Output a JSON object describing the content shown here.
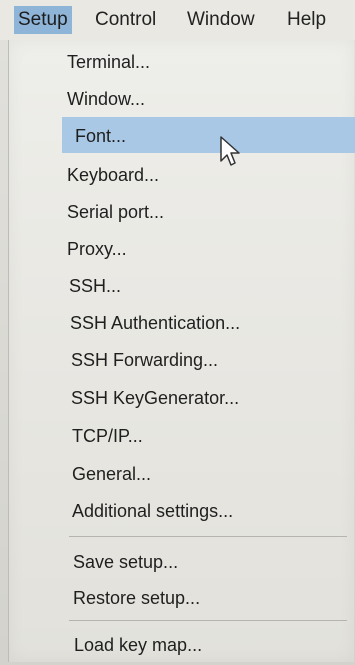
{
  "menubar": {
    "items": [
      {
        "label": "Setup",
        "active": true
      },
      {
        "label": "Control",
        "active": false
      },
      {
        "label": "Window",
        "active": false
      },
      {
        "label": "Help",
        "active": false
      }
    ]
  },
  "setup_menu": {
    "items": [
      {
        "label": "Terminal..."
      },
      {
        "label": "Window..."
      },
      {
        "label": "Font...",
        "highlighted": true
      },
      {
        "label": "Keyboard..."
      },
      {
        "label": "Serial port..."
      },
      {
        "label": "Proxy..."
      },
      {
        "label": "SSH..."
      },
      {
        "label": "SSH Authentication..."
      },
      {
        "label": "SSH Forwarding..."
      },
      {
        "label": "SSH KeyGenerator..."
      },
      {
        "label": "TCP/IP..."
      },
      {
        "label": "General..."
      },
      {
        "label": "Additional settings..."
      },
      {
        "label": "Save setup..."
      },
      {
        "label": "Restore setup..."
      },
      {
        "label": "Load key map..."
      }
    ]
  },
  "colors": {
    "menubar_active": "#8eb4d8",
    "item_highlight": "#a9c8e6"
  },
  "icons": {
    "cursor": "mouse-pointer-icon"
  }
}
